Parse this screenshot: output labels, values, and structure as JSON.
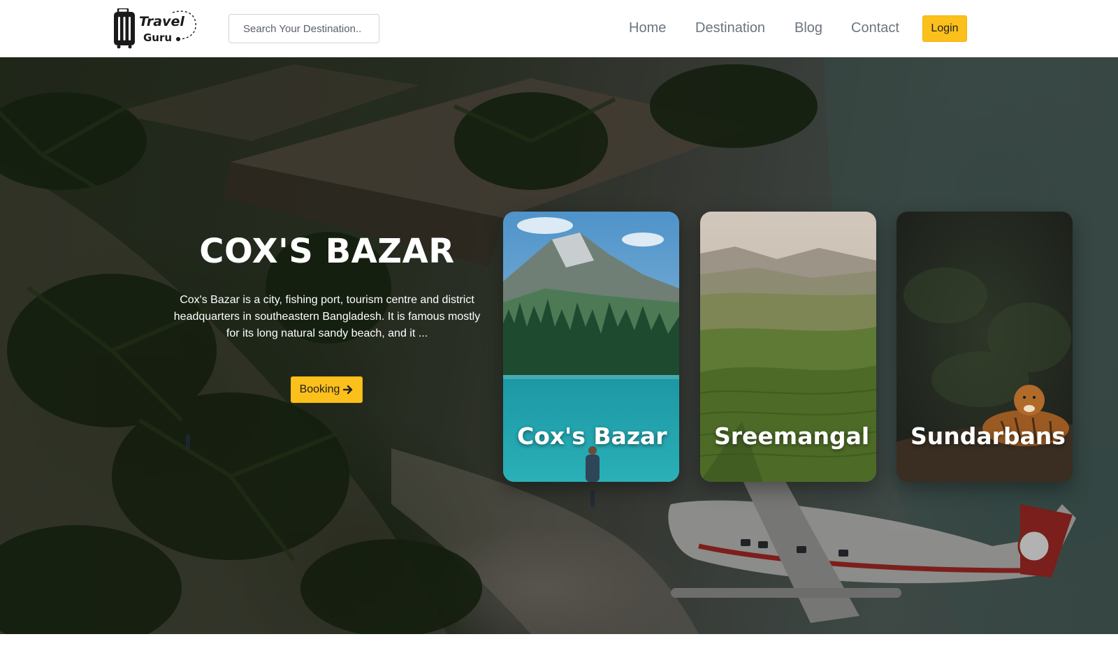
{
  "brand": {
    "logo_line_1": "Travel",
    "logo_line_2": "Guru"
  },
  "search": {
    "placeholder": "Search Your Destination.."
  },
  "nav": {
    "items": [
      {
        "label": "Home"
      },
      {
        "label": "Destination"
      },
      {
        "label": "Blog"
      },
      {
        "label": "Contact"
      }
    ],
    "login_label": "Login"
  },
  "hero": {
    "title": "COX'S BAZAR",
    "description": "Cox's Bazar is a city, fishing port, tourism centre and district headquarters in southeastern Bangladesh. It is famous mostly for its long natural sandy beach, and it ...",
    "booking_label": "Booking"
  },
  "cards": [
    {
      "label": "Cox's Bazar"
    },
    {
      "label": "Sreemangal"
    },
    {
      "label": "Sundarbans"
    }
  ],
  "colors": {
    "accent": "#fbc01b",
    "nav_text": "#6c757d"
  },
  "icons": {
    "booking": "arrow-right-icon",
    "logo": "suitcase-icon"
  }
}
